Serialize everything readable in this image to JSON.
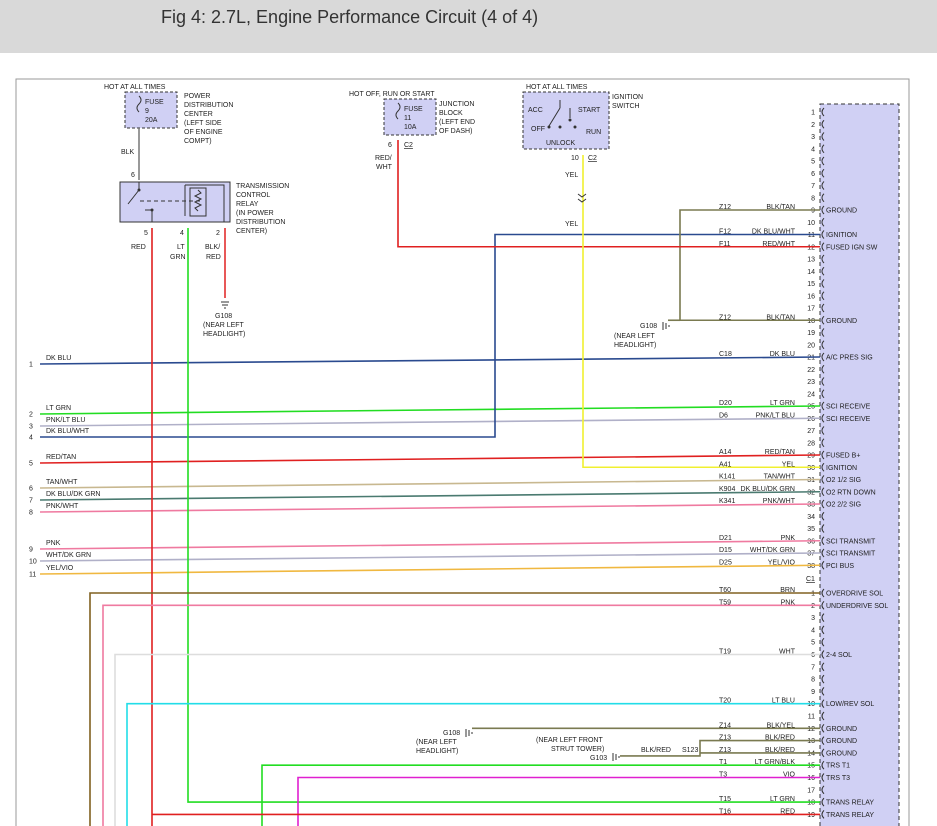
{
  "header": {
    "title": "Fig 4: 2.7L, Engine Performance Circuit (4 of 4)"
  },
  "colors": {
    "header_bg": "#d9d9d9",
    "pcm_fill": "#d0d0f4",
    "component_fill": "#d0d0f4",
    "red": "#e02020",
    "green": "#22dd22",
    "blue_dk": "#2a4a8f",
    "yellow": "#f0f030",
    "olive": "#7a7a50",
    "brown": "#806020",
    "pink": "#ef7aa0",
    "lavender": "#b0b0c8",
    "cyan": "#22dde8",
    "magenta": "#e020d0",
    "white_wire": "#dddddd",
    "tan": "#c8b890",
    "orange": "#f0b840",
    "dkgreen": "#4a7a70"
  },
  "components": {
    "fuse9": {
      "hot_label": "HOT AT ALL TIMES",
      "lines": [
        "FUSE",
        "9",
        "20A"
      ],
      "desc": [
        "POWER",
        "DISTRIBUTION",
        "CENTER",
        "(LEFT SIDE",
        "OF ENGINE",
        "COMPT)"
      ],
      "wire": "BLK"
    },
    "relay": {
      "pin_top": "6",
      "desc": [
        "TRANSMISSION",
        "CONTROL",
        "RELAY",
        "(IN POWER",
        "DISTRIBUTION",
        "CENTER)"
      ],
      "pins": [
        "5",
        "4",
        "2"
      ],
      "wires": [
        "RED",
        "LT",
        "GRN",
        "BLK/",
        "RED"
      ]
    },
    "g108_top": {
      "label": "G108",
      "desc": [
        "(NEAR LEFT",
        "HEADLIGHT)"
      ]
    },
    "fuse11": {
      "hot_label": "HOT OFF, RUN OR START",
      "lines": [
        "FUSE",
        "11",
        "10A"
      ],
      "desc": [
        "JUNCTION",
        "BLOCK",
        "(LEFT END",
        "OF DASH)"
      ],
      "pin": "6",
      "conn": "C2",
      "wire": [
        "RED/",
        "WHT"
      ]
    },
    "ignition": {
      "hot_label": "HOT AT ALL TIMES",
      "positions": [
        "ACC",
        "START",
        "OFF",
        "RUN",
        "UNLOCK"
      ],
      "desc": [
        "IGNITION",
        "SWITCH"
      ],
      "pin": "10",
      "conn": "C2",
      "wire_top": "YEL",
      "wire_bottom": "YEL"
    },
    "g108_mid": {
      "label": "G108",
      "desc": [
        "(NEAR LEFT",
        "HEADLIGHT)"
      ]
    },
    "g108_low": {
      "label": "G108",
      "desc": [
        "(NEAR LEFT",
        "HEADLIGHT)"
      ]
    },
    "g103": {
      "label": "G103",
      "desc": [
        "(NEAR LEFT FRONT",
        "STRUT TOWER)"
      ],
      "wire": "BLK/RED",
      "splice": "S123"
    }
  },
  "left_wires": [
    {
      "num": "1",
      "label": "DK BLU"
    },
    {
      "num": "2",
      "label": "LT GRN"
    },
    {
      "num": "3",
      "label": "PNK/LT BLU"
    },
    {
      "num": "4",
      "label": "DK BLU/WHT"
    },
    {
      "num": "5",
      "label": "RED/TAN"
    },
    {
      "num": "6",
      "label": "TAN/WHT"
    },
    {
      "num": "7",
      "label": "DK BLU/DK GRN"
    },
    {
      "num": "8",
      "label": "PNK/WHT"
    },
    {
      "num": "9",
      "label": "PNK"
    },
    {
      "num": "10",
      "label": "WHT/DK GRN"
    },
    {
      "num": "11",
      "label": "YEL/VIO"
    }
  ],
  "pcm_c1": [
    {
      "pin": "1"
    },
    {
      "pin": "2"
    },
    {
      "pin": "3"
    },
    {
      "pin": "4"
    },
    {
      "pin": "5"
    },
    {
      "pin": "6"
    },
    {
      "pin": "7"
    },
    {
      "pin": "8"
    },
    {
      "pin": "9",
      "circuit": "Z12",
      "wire": "BLK/TAN",
      "function": "GROUND"
    },
    {
      "pin": "10"
    },
    {
      "pin": "11",
      "circuit": "F12",
      "wire": "DK BLU/WHT",
      "function": "IGNITION"
    },
    {
      "pin": "12",
      "circuit": "F11",
      "wire": "RED/WHT",
      "function": "FUSED IGN SW"
    },
    {
      "pin": "13"
    },
    {
      "pin": "14"
    },
    {
      "pin": "15"
    },
    {
      "pin": "16"
    },
    {
      "pin": "17"
    },
    {
      "pin": "18",
      "circuit": "Z12",
      "wire": "BLK/TAN",
      "function": "GROUND"
    },
    {
      "pin": "19"
    },
    {
      "pin": "20"
    },
    {
      "pin": "21",
      "circuit": "C18",
      "wire": "DK BLU",
      "function": "A/C PRES SIG"
    },
    {
      "pin": "22"
    },
    {
      "pin": "23"
    },
    {
      "pin": "24"
    },
    {
      "pin": "25",
      "circuit": "D20",
      "wire": "LT GRN",
      "function": "SCI RECEIVE"
    },
    {
      "pin": "26",
      "circuit": "D6",
      "wire": "PNK/LT BLU",
      "function": "SCI RECEIVE"
    },
    {
      "pin": "27"
    },
    {
      "pin": "28"
    },
    {
      "pin": "29",
      "circuit": "A14",
      "wire": "RED/TAN",
      "function": "FUSED B+"
    },
    {
      "pin": "30",
      "circuit": "A41",
      "wire": "YEL",
      "function": "IGNITION"
    },
    {
      "pin": "31",
      "circuit": "K141",
      "wire": "TAN/WHT",
      "function": "O2 1/2 SIG"
    },
    {
      "pin": "32",
      "circuit": "K904",
      "wire": "DK BLU/DK GRN",
      "function": "O2 RTN DOWN"
    },
    {
      "pin": "33",
      "circuit": "K341",
      "wire": "PNK/WHT",
      "function": "O2 2/2 SIG"
    },
    {
      "pin": "34"
    },
    {
      "pin": "35"
    },
    {
      "pin": "36",
      "circuit": "D21",
      "wire": "PNK",
      "function": "SCI TRANSMIT"
    },
    {
      "pin": "37",
      "circuit": "D15",
      "wire": "WHT/DK GRN",
      "function": "SCI TRANSMIT"
    },
    {
      "pin": "38",
      "circuit": "D25",
      "wire": "YEL/VIO",
      "function": "PCI BUS"
    }
  ],
  "conn_c1": "C1",
  "pcm_c2": [
    {
      "pin": "1",
      "circuit": "T60",
      "wire": "BRN",
      "function": "OVERDRIVE SOL"
    },
    {
      "pin": "2",
      "circuit": "T59",
      "wire": "PNK",
      "function": "UNDERDRIVE SOL"
    },
    {
      "pin": "3"
    },
    {
      "pin": "4"
    },
    {
      "pin": "5"
    },
    {
      "pin": "6",
      "circuit": "T19",
      "wire": "WHT",
      "function": "2-4 SOL"
    },
    {
      "pin": "7"
    },
    {
      "pin": "8"
    },
    {
      "pin": "9"
    },
    {
      "pin": "10",
      "circuit": "T20",
      "wire": "LT BLU",
      "function": "LOW/REV SOL"
    },
    {
      "pin": "11"
    },
    {
      "pin": "12",
      "circuit": "Z14",
      "wire": "BLK/YEL",
      "function": "GROUND"
    },
    {
      "pin": "13",
      "circuit": "Z13",
      "wire": "BLK/RED",
      "function": "GROUND"
    },
    {
      "pin": "14",
      "circuit": "Z13",
      "wire": "BLK/RED",
      "function": "GROUND"
    },
    {
      "pin": "15",
      "circuit": "T1",
      "wire": "LT GRN/BLK",
      "function": "TRS T1"
    },
    {
      "pin": "16",
      "circuit": "T3",
      "wire": "VIO",
      "function": "TRS T3"
    },
    {
      "pin": "17"
    },
    {
      "pin": "18",
      "circuit": "T15",
      "wire": "LT GRN",
      "function": "TRANS RELAY"
    },
    {
      "pin": "19",
      "circuit": "T16",
      "wire": "RED",
      "function": "TRANS RELAY"
    }
  ]
}
